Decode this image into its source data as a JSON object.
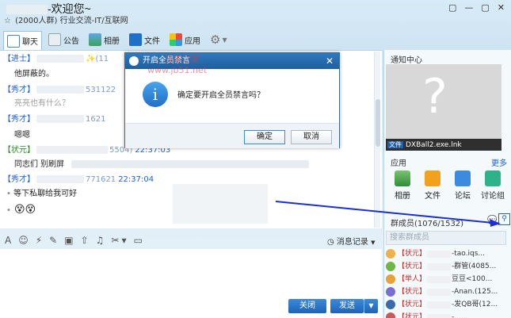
{
  "window": {
    "title_suffix": "-欢迎您~",
    "subtitle_count": "(2000人群)",
    "subtitle_category": "行业交流-IT/互联网",
    "btn_skin": "▢",
    "btn_min": "—",
    "btn_max": "▢",
    "btn_close": "✕"
  },
  "toolbar": {
    "tabs": [
      {
        "label": "聊天"
      },
      {
        "label": "公告"
      },
      {
        "label": "相册"
      },
      {
        "label": "文件"
      },
      {
        "label": "应用"
      }
    ]
  },
  "chat": {
    "messages": [
      {
        "rank": "【进士】",
        "id": "(11",
        "time": ""
      },
      {
        "rank": "【秀才】",
        "id": "531122",
        "time": ""
      },
      {
        "rank": "【秀才】",
        "id": "1621",
        "time": ""
      },
      {
        "rank": "【状元】",
        "id": "5504)",
        "time": "22:37:03"
      },
      {
        "rank": "【秀才】",
        "id": "771621",
        "time": "22:37:04"
      }
    ],
    "texts": [
      "他屏蔽的。",
      "亮亮也有什么？",
      "嗯嗯",
      "同志们 别刷屏",
      "等下私聊给我可好"
    ],
    "emoji": "😵😵"
  },
  "input": {
    "history_label": "消息记录",
    "close_label": "关闭",
    "send_label": "发送"
  },
  "dialog": {
    "title": "开启全员禁言",
    "message": "确定要开启全员禁言吗？",
    "ok_label": "确定",
    "cancel_label": "取消",
    "watermark1": "脚本之家",
    "watermark2": "www.jb51.net"
  },
  "right_panel": {
    "notice_title": "通知中心",
    "file_tag": "文件",
    "file_name": "DXBall2.exe.lnk",
    "apps_title": "应用",
    "more_label": "更多",
    "apps": [
      {
        "label": "相册"
      },
      {
        "label": "文件"
      },
      {
        "label": "论坛"
      },
      {
        "label": "讨论组"
      }
    ],
    "members_title": "群成员(1076/1532)",
    "search_placeholder": "搜索群成员",
    "members": [
      {
        "rank": "【状元】",
        "name": "-tao.iqs..."
      },
      {
        "rank": "【状元】",
        "name": "-群管(4085..."
      },
      {
        "rank": "【举人】",
        "name": "豆豆<100..."
      },
      {
        "rank": "【状元】",
        "name": "-Anan.(125..."
      },
      {
        "rank": "【状元】",
        "name": "-发QB哥(12..."
      },
      {
        "rank": "【状元】",
        "name": "-......"
      }
    ]
  },
  "colors": {
    "accent": "#1f63b8",
    "rank_blue": "#1f5fd0",
    "rank_green": "#2a8a2a",
    "member_rank": "#dd2222"
  }
}
